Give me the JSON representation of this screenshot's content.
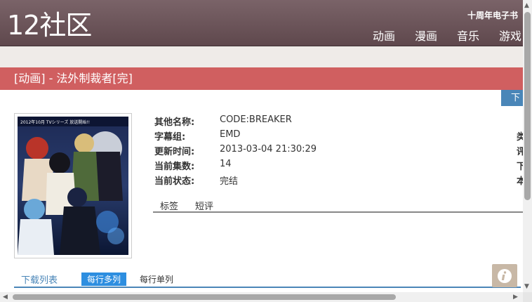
{
  "header": {
    "logo": "12社区",
    "anniversary": "十周年电子书",
    "nav": [
      "动画",
      "漫画",
      "音乐",
      "游戏"
    ]
  },
  "title_bar": {
    "title": "[动画] - 法外制裁者[完]"
  },
  "download_button": {
    "label": "下"
  },
  "cover": {
    "image_alt": "cover art",
    "top_caption": "2012年10月 TVシリーズ 放送開始!!"
  },
  "details": [
    {
      "label": "其他名称:",
      "value": "CODE:BREAKER",
      "right": ""
    },
    {
      "label": "字幕组:",
      "value": "EMD",
      "right": "类"
    },
    {
      "label": "更新时间:",
      "value": "2013-03-04 21:30:29",
      "right": "评"
    },
    {
      "label": "当前集数:",
      "value": "14",
      "right": "下"
    },
    {
      "label": "当前状态:",
      "value": "完结",
      "right": "本"
    }
  ],
  "tabs": [
    "标签",
    "短评"
  ],
  "download_list": {
    "title": "下载列表",
    "multi": "每行多列",
    "single": "每行单列"
  },
  "icons": {
    "info": "info-icon",
    "scroll_up": "arrow-up-icon",
    "scroll_down": "arrow-down-icon",
    "scroll_left": "arrow-left-icon",
    "scroll_right": "arrow-right-icon"
  },
  "colors": {
    "header": "#6b5458",
    "title_bar": "#d05f60",
    "accent_blue": "#4a86b8",
    "button_blue": "#2d8ee0"
  }
}
